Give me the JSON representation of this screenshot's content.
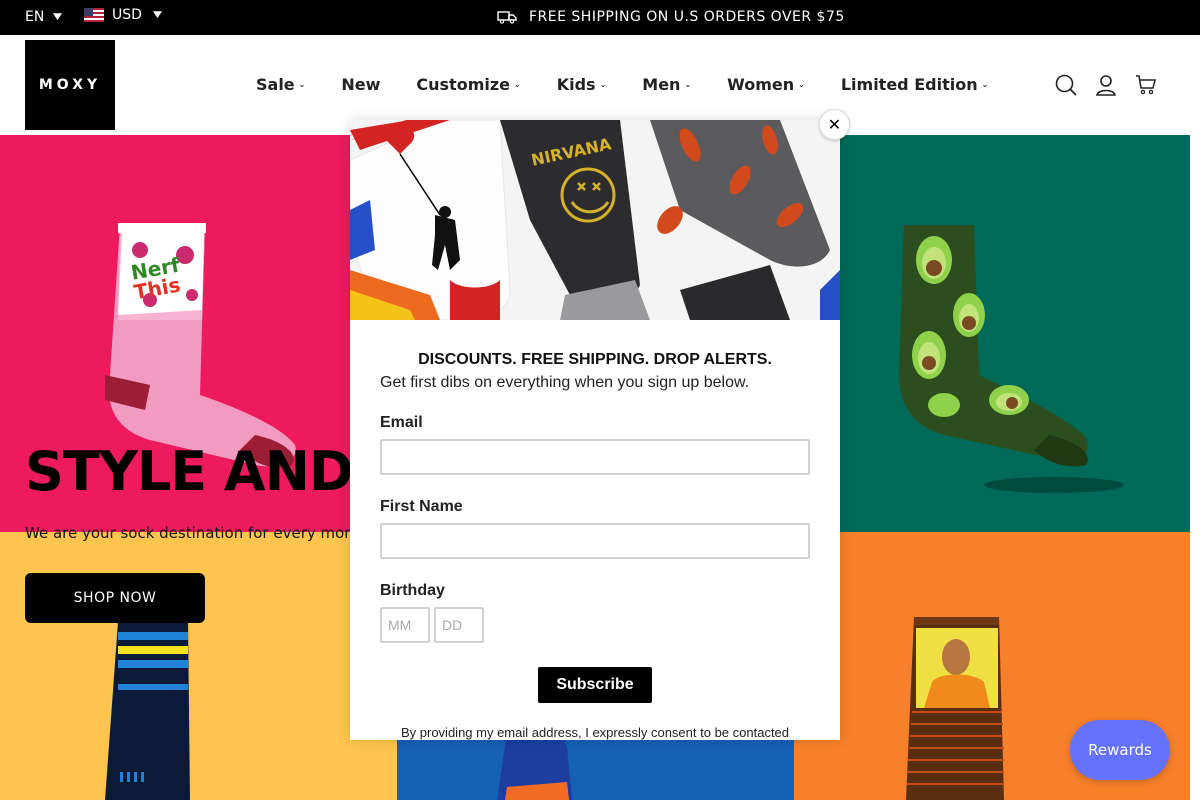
{
  "topbar": {
    "language": "EN",
    "currency": "USD",
    "shipping_text": "FREE SHIPPING ON U.S ORDERS OVER $75"
  },
  "header": {
    "logo_text": "MOXY",
    "nav": [
      {
        "label": "Sale",
        "has_dropdown": true
      },
      {
        "label": "New",
        "has_dropdown": false
      },
      {
        "label": "Customize",
        "has_dropdown": true
      },
      {
        "label": "Kids",
        "has_dropdown": true
      },
      {
        "label": "Men",
        "has_dropdown": true
      },
      {
        "label": "Women",
        "has_dropdown": true
      },
      {
        "label": "Limited Edition",
        "has_dropdown": true
      }
    ],
    "icons": [
      "search-icon",
      "account-icon",
      "cart-icon"
    ]
  },
  "hero": {
    "title": "STYLE AND CO",
    "subtitle": "We are your sock destination for every moment.",
    "button": "SHOP NOW",
    "sock_text": "Nerf This",
    "colors": {
      "pink": "#ee1a5e",
      "teal": "#006a59",
      "yellow": "#fdc54e",
      "blue": "#1561b4",
      "orange": "#f7802a"
    }
  },
  "modal": {
    "close_label": "✕",
    "heading": "DISCOUNTS. FREE SHIPPING. DROP ALERTS.",
    "subheading": "Get first dibs on everything when you sign up below.",
    "email_label": "Email",
    "email_value": "",
    "first_name_label": "First Name",
    "first_name_value": "",
    "birthday_label": "Birthday",
    "month_placeholder": "MM",
    "day_placeholder": "DD",
    "subscribe_label": "Subscribe",
    "consent_text": "By providing my email address, I expressly consent to be contacted",
    "image_text": "NIRVANA"
  },
  "rewards_label": "Rewards"
}
